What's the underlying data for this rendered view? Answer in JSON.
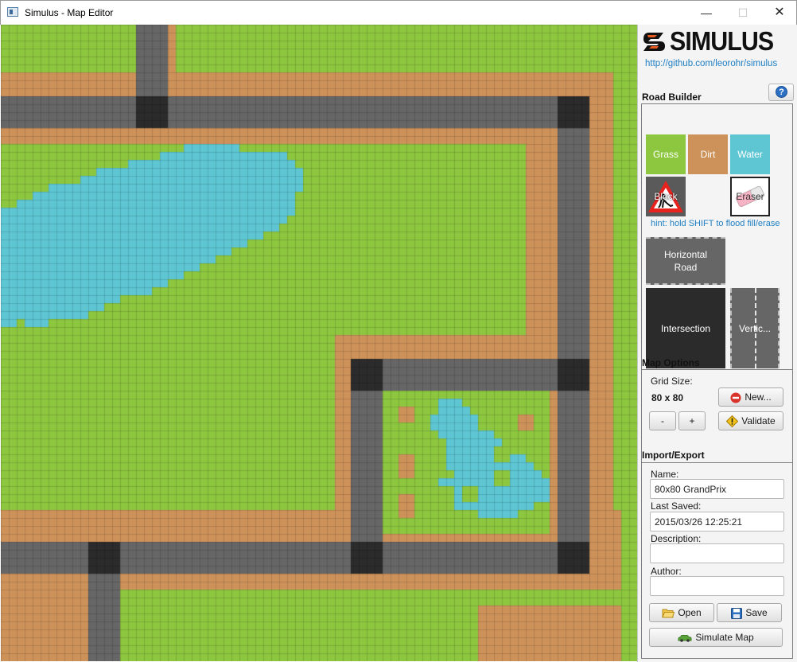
{
  "window": {
    "title": "Simulus - Map Editor",
    "minimize_glyph": "—",
    "maximize_glyph": "☐",
    "close_glyph": "✕"
  },
  "logo": {
    "text": "SIMULUS",
    "link": "http://github.com/leorohr/simulus"
  },
  "help_button": {
    "glyph": "?"
  },
  "road_builder": {
    "title": "Road Builder",
    "tiles": {
      "grass": "Grass",
      "dirt": "Dirt",
      "water": "Water",
      "block": "Block",
      "eraser": "Eraser",
      "horizontal_road": "Horizontal Road",
      "intersection": "Intersection",
      "vertical_road": "Vertic..."
    },
    "hint": "hint: hold SHIFT to flood fill/erase"
  },
  "map_options": {
    "title": "Map Options",
    "grid_size_label": "Grid Size:",
    "grid_size_value": "80 x 80",
    "decrease_label": "-",
    "increase_label": "+",
    "new_label": "New...",
    "validate_label": "Validate"
  },
  "import_export": {
    "title": "Import/Export",
    "name_label": "Name:",
    "name_value": "80x80 GrandPrix",
    "last_saved_label": "Last Saved:",
    "last_saved_value": "2015/03/26 12:25:21",
    "description_label": "Description:",
    "description_value": "",
    "author_label": "Author:",
    "author_value": "",
    "open_label": "Open",
    "save_label": "Save",
    "simulate_label": "Simulate Map"
  },
  "map": {
    "grid": "80x80",
    "colors": {
      "grass": "#8dc63f",
      "dirt": "#cd925a",
      "water": "#5ec6d3",
      "road": "#666666",
      "intersection": "#2b2b2b"
    }
  }
}
